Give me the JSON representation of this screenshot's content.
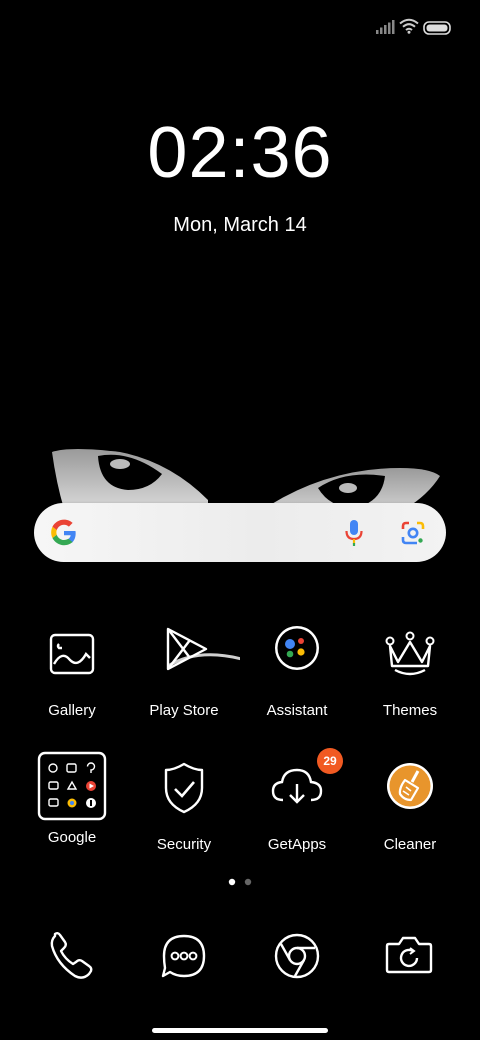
{
  "status": {
    "icons": [
      "signal-icon",
      "wifi-icon",
      "battery-icon"
    ]
  },
  "lockscreen": {
    "time": "02:36",
    "date": "Mon, March 14"
  },
  "search": {
    "icons": [
      "google-logo-icon",
      "microphone-icon",
      "google-lens-icon"
    ],
    "colors": {
      "blue": "#4285F4",
      "red": "#EA4335",
      "yellow": "#FBBC05",
      "green": "#34A853"
    }
  },
  "apps_row1": [
    {
      "label": "Gallery",
      "icon": "gallery-icon"
    },
    {
      "label": "Play Store",
      "icon": "play-store-icon"
    },
    {
      "label": "Assistant",
      "icon": "assistant-icon"
    },
    {
      "label": "Themes",
      "icon": "crown-icon"
    }
  ],
  "apps_row2": [
    {
      "label": "Google",
      "icon": "google-folder-icon"
    },
    {
      "label": "Security",
      "icon": "shield-icon"
    },
    {
      "label": "GetApps",
      "icon": "cloud-download-icon",
      "badge": "29"
    },
    {
      "label": "Cleaner",
      "icon": "broom-icon"
    }
  ],
  "badge_color": "#f15a22",
  "cleaner_color": "#e8952c",
  "pages": {
    "count": 2,
    "current": 1
  },
  "dock": [
    {
      "icon": "phone-icon"
    },
    {
      "icon": "messages-icon"
    },
    {
      "icon": "chrome-icon"
    },
    {
      "icon": "camera-icon"
    }
  ]
}
